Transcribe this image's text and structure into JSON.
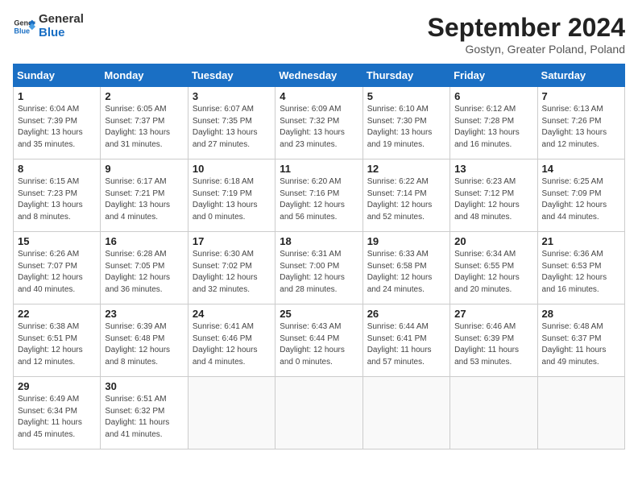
{
  "header": {
    "logo_line1": "General",
    "logo_line2": "Blue",
    "month": "September 2024",
    "location": "Gostyn, Greater Poland, Poland"
  },
  "weekdays": [
    "Sunday",
    "Monday",
    "Tuesday",
    "Wednesday",
    "Thursday",
    "Friday",
    "Saturday"
  ],
  "weeks": [
    [
      {
        "day": "1",
        "info": "Sunrise: 6:04 AM\nSunset: 7:39 PM\nDaylight: 13 hours\nand 35 minutes."
      },
      {
        "day": "2",
        "info": "Sunrise: 6:05 AM\nSunset: 7:37 PM\nDaylight: 13 hours\nand 31 minutes."
      },
      {
        "day": "3",
        "info": "Sunrise: 6:07 AM\nSunset: 7:35 PM\nDaylight: 13 hours\nand 27 minutes."
      },
      {
        "day": "4",
        "info": "Sunrise: 6:09 AM\nSunset: 7:32 PM\nDaylight: 13 hours\nand 23 minutes."
      },
      {
        "day": "5",
        "info": "Sunrise: 6:10 AM\nSunset: 7:30 PM\nDaylight: 13 hours\nand 19 minutes."
      },
      {
        "day": "6",
        "info": "Sunrise: 6:12 AM\nSunset: 7:28 PM\nDaylight: 13 hours\nand 16 minutes."
      },
      {
        "day": "7",
        "info": "Sunrise: 6:13 AM\nSunset: 7:26 PM\nDaylight: 13 hours\nand 12 minutes."
      }
    ],
    [
      {
        "day": "8",
        "info": "Sunrise: 6:15 AM\nSunset: 7:23 PM\nDaylight: 13 hours\nand 8 minutes."
      },
      {
        "day": "9",
        "info": "Sunrise: 6:17 AM\nSunset: 7:21 PM\nDaylight: 13 hours\nand 4 minutes."
      },
      {
        "day": "10",
        "info": "Sunrise: 6:18 AM\nSunset: 7:19 PM\nDaylight: 13 hours\nand 0 minutes."
      },
      {
        "day": "11",
        "info": "Sunrise: 6:20 AM\nSunset: 7:16 PM\nDaylight: 12 hours\nand 56 minutes."
      },
      {
        "day": "12",
        "info": "Sunrise: 6:22 AM\nSunset: 7:14 PM\nDaylight: 12 hours\nand 52 minutes."
      },
      {
        "day": "13",
        "info": "Sunrise: 6:23 AM\nSunset: 7:12 PM\nDaylight: 12 hours\nand 48 minutes."
      },
      {
        "day": "14",
        "info": "Sunrise: 6:25 AM\nSunset: 7:09 PM\nDaylight: 12 hours\nand 44 minutes."
      }
    ],
    [
      {
        "day": "15",
        "info": "Sunrise: 6:26 AM\nSunset: 7:07 PM\nDaylight: 12 hours\nand 40 minutes."
      },
      {
        "day": "16",
        "info": "Sunrise: 6:28 AM\nSunset: 7:05 PM\nDaylight: 12 hours\nand 36 minutes."
      },
      {
        "day": "17",
        "info": "Sunrise: 6:30 AM\nSunset: 7:02 PM\nDaylight: 12 hours\nand 32 minutes."
      },
      {
        "day": "18",
        "info": "Sunrise: 6:31 AM\nSunset: 7:00 PM\nDaylight: 12 hours\nand 28 minutes."
      },
      {
        "day": "19",
        "info": "Sunrise: 6:33 AM\nSunset: 6:58 PM\nDaylight: 12 hours\nand 24 minutes."
      },
      {
        "day": "20",
        "info": "Sunrise: 6:34 AM\nSunset: 6:55 PM\nDaylight: 12 hours\nand 20 minutes."
      },
      {
        "day": "21",
        "info": "Sunrise: 6:36 AM\nSunset: 6:53 PM\nDaylight: 12 hours\nand 16 minutes."
      }
    ],
    [
      {
        "day": "22",
        "info": "Sunrise: 6:38 AM\nSunset: 6:51 PM\nDaylight: 12 hours\nand 12 minutes."
      },
      {
        "day": "23",
        "info": "Sunrise: 6:39 AM\nSunset: 6:48 PM\nDaylight: 12 hours\nand 8 minutes."
      },
      {
        "day": "24",
        "info": "Sunrise: 6:41 AM\nSunset: 6:46 PM\nDaylight: 12 hours\nand 4 minutes."
      },
      {
        "day": "25",
        "info": "Sunrise: 6:43 AM\nSunset: 6:44 PM\nDaylight: 12 hours\nand 0 minutes."
      },
      {
        "day": "26",
        "info": "Sunrise: 6:44 AM\nSunset: 6:41 PM\nDaylight: 11 hours\nand 57 minutes."
      },
      {
        "day": "27",
        "info": "Sunrise: 6:46 AM\nSunset: 6:39 PM\nDaylight: 11 hours\nand 53 minutes."
      },
      {
        "day": "28",
        "info": "Sunrise: 6:48 AM\nSunset: 6:37 PM\nDaylight: 11 hours\nand 49 minutes."
      }
    ],
    [
      {
        "day": "29",
        "info": "Sunrise: 6:49 AM\nSunset: 6:34 PM\nDaylight: 11 hours\nand 45 minutes."
      },
      {
        "day": "30",
        "info": "Sunrise: 6:51 AM\nSunset: 6:32 PM\nDaylight: 11 hours\nand 41 minutes."
      },
      {
        "day": "",
        "info": ""
      },
      {
        "day": "",
        "info": ""
      },
      {
        "day": "",
        "info": ""
      },
      {
        "day": "",
        "info": ""
      },
      {
        "day": "",
        "info": ""
      }
    ]
  ]
}
